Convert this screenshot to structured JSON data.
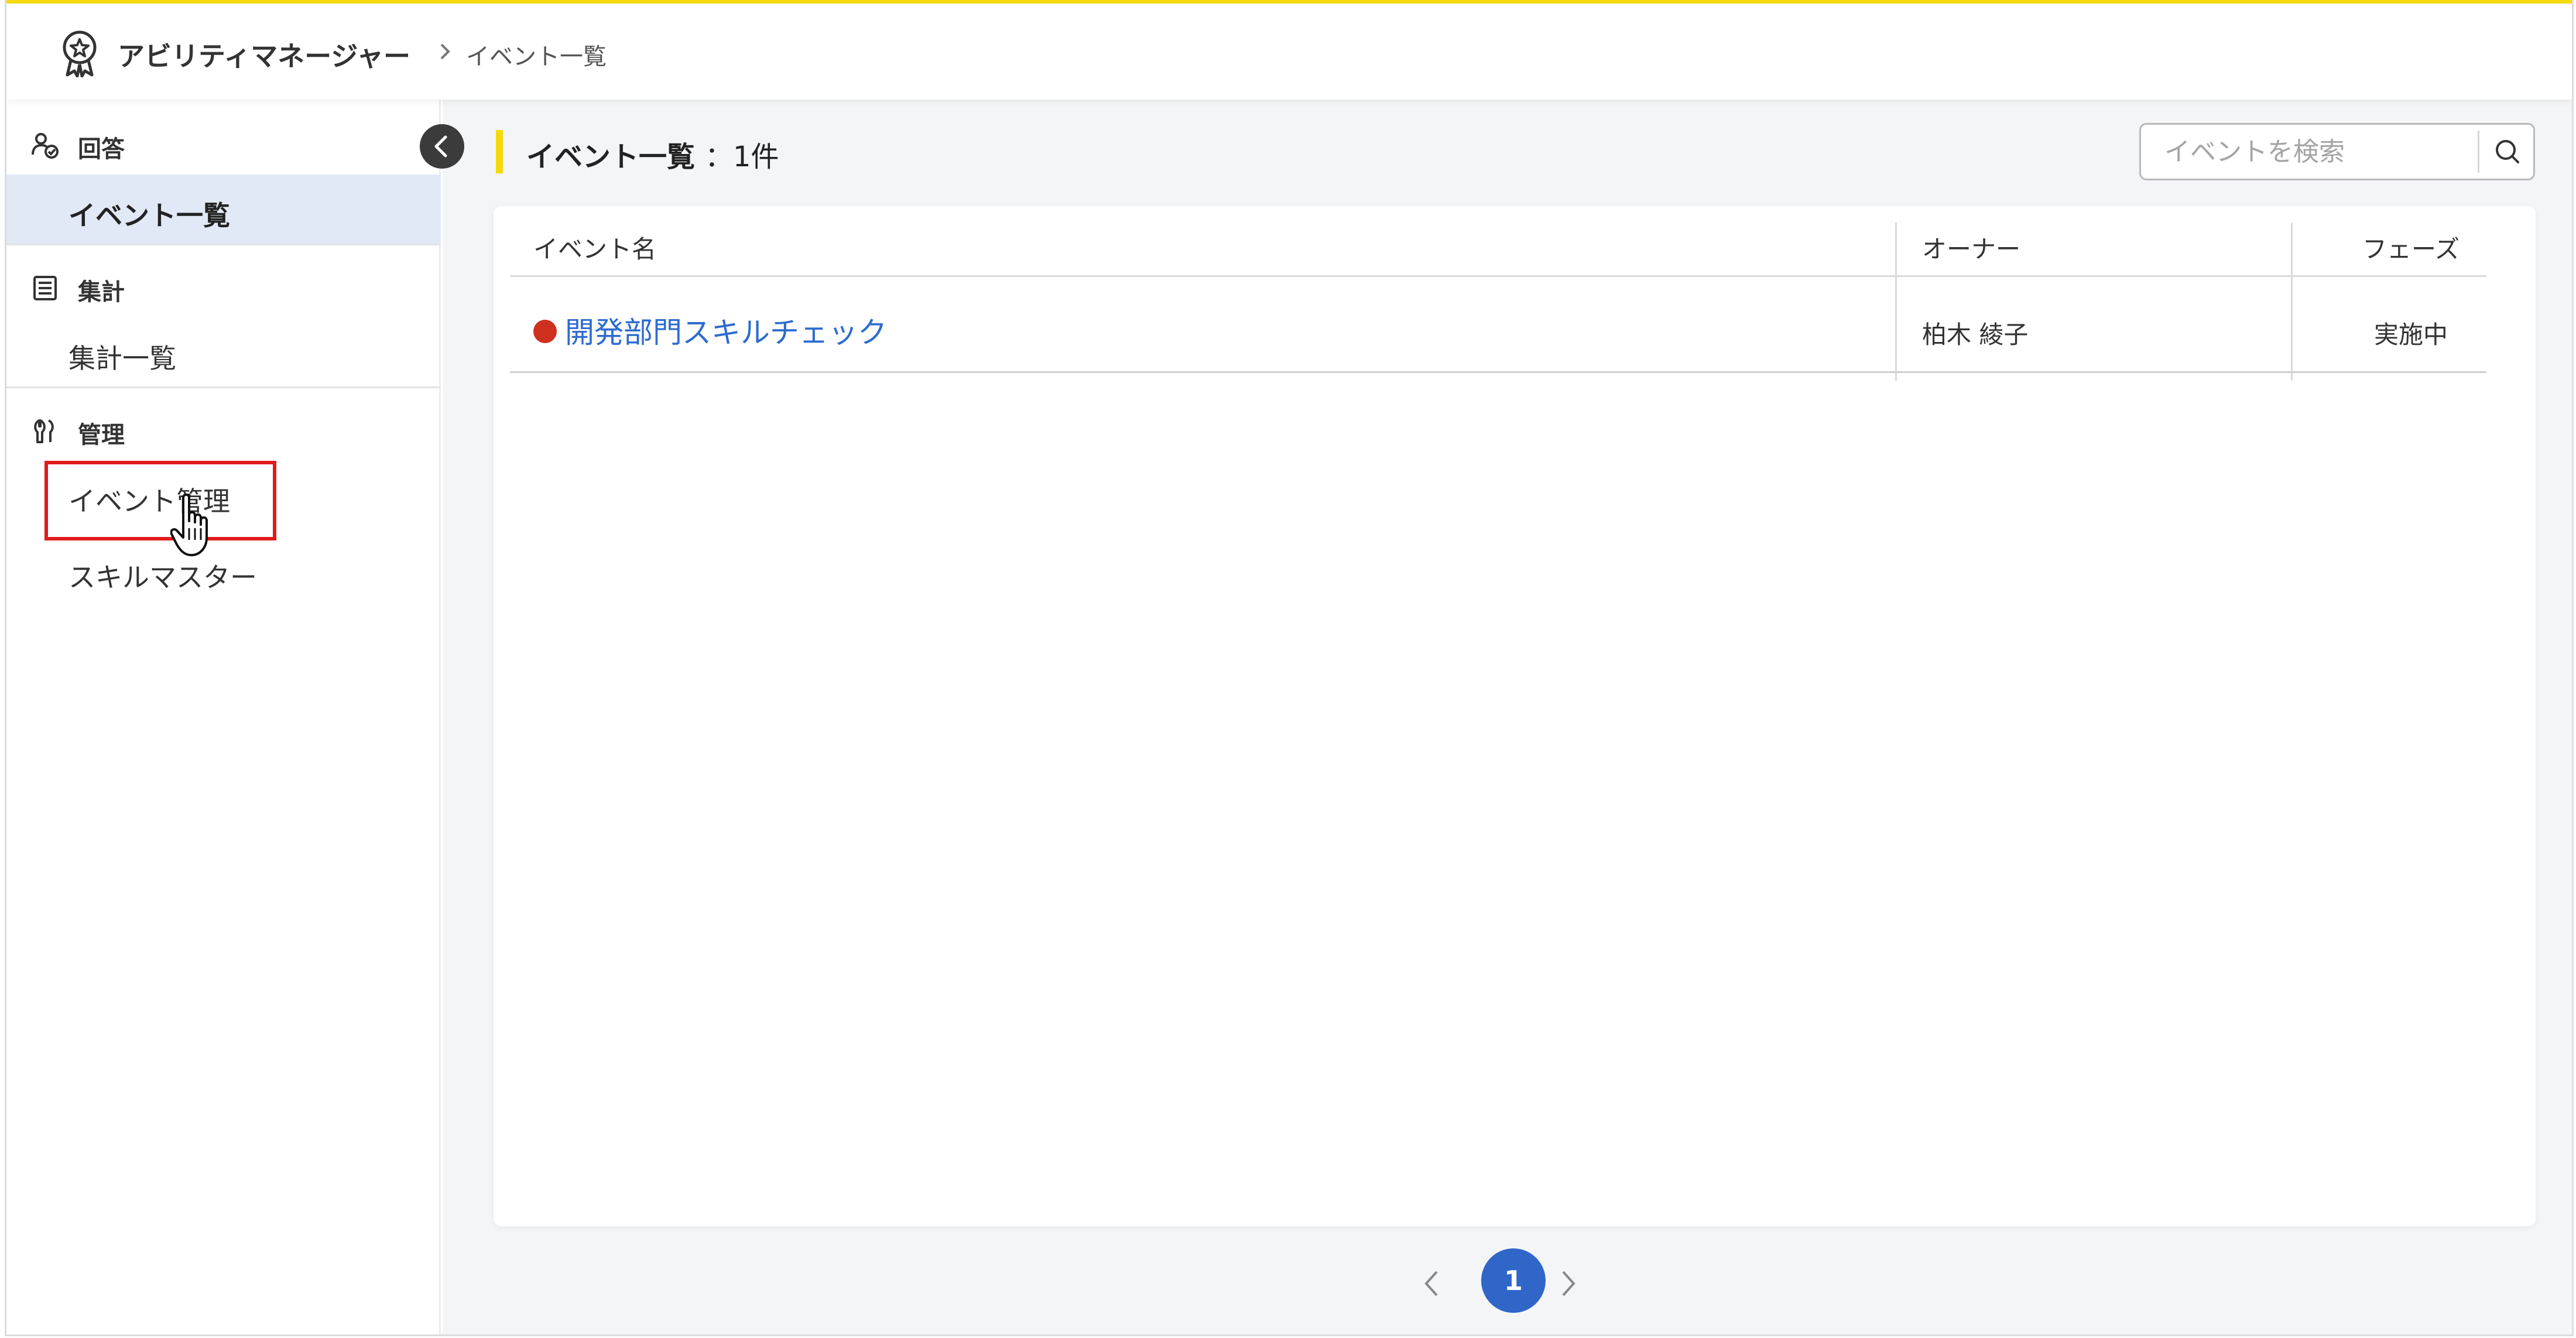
{
  "header": {
    "app_title": "アビリティマネージャー",
    "breadcrumb_current": "イベント一覧"
  },
  "sidebar": {
    "sections": [
      {
        "label": "回答",
        "icon": "person-check-icon",
        "items": [
          {
            "label": "イベント一覧",
            "active": true
          }
        ]
      },
      {
        "label": "集計",
        "icon": "list-document-icon",
        "items": [
          {
            "label": "集計一覧",
            "active": false
          }
        ]
      },
      {
        "label": "管理",
        "icon": "wrench-icon",
        "items": [
          {
            "label": "イベント管理",
            "active": false,
            "highlighted": true
          },
          {
            "label": "スキルマスター",
            "active": false
          }
        ]
      }
    ]
  },
  "main": {
    "title": "イベント一覧",
    "count_label": "：1件",
    "search": {
      "placeholder": "イベントを検索",
      "value": ""
    },
    "table": {
      "columns": [
        "イベント名",
        "オーナー",
        "フェーズ"
      ],
      "rows": [
        {
          "event_name": "開発部門スキルチェック",
          "owner": "柏木 綾子",
          "phase": "実施中",
          "status_color": "#d0301f"
        }
      ]
    },
    "pagination": {
      "current_page": "1"
    }
  },
  "colors": {
    "accent_yellow": "#f5d90a",
    "active_nav_bg": "#e1e8f6",
    "link_blue": "#2d6ccf",
    "page_blue": "#3066c8",
    "highlight_red": "#e11b1b"
  }
}
